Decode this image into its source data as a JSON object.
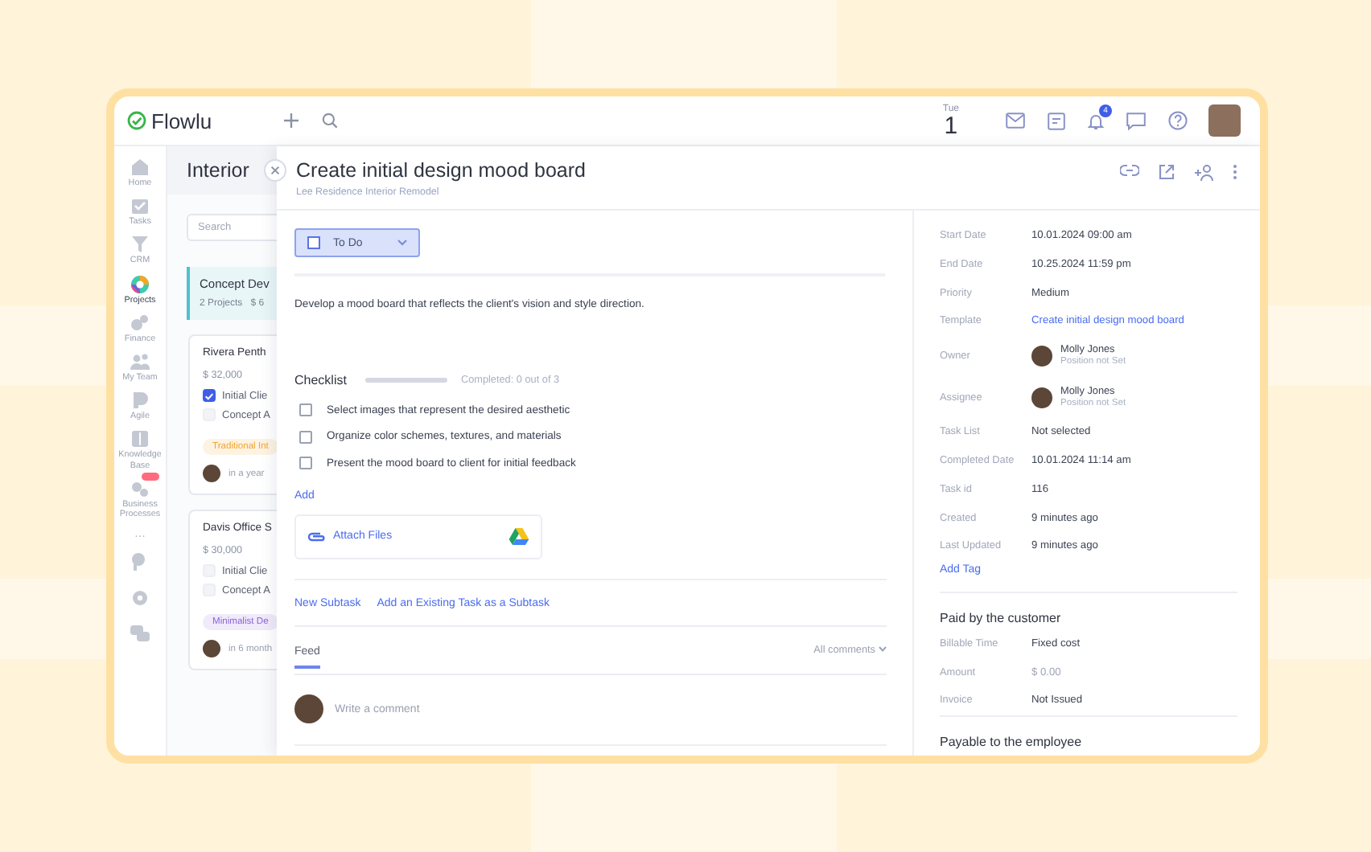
{
  "app": {
    "logo": "Flowlu"
  },
  "header": {
    "weekday": "Tue",
    "day": "1",
    "notifications": "4"
  },
  "sidebar": {
    "items": [
      {
        "label": "Home",
        "selected": false,
        "badge": false
      },
      {
        "label": "Tasks",
        "selected": false,
        "badge": false
      },
      {
        "label": "CRM",
        "selected": false,
        "badge": false
      },
      {
        "label": "Projects",
        "selected": true,
        "badge": false
      },
      {
        "label": "Finance",
        "selected": false,
        "badge": false
      },
      {
        "label": "My Team",
        "selected": false,
        "badge": false
      },
      {
        "label": "Agile",
        "selected": false,
        "badge": false
      },
      {
        "label": "Knowledge Base",
        "selected": false,
        "badge": false
      },
      {
        "label": "Business Processes",
        "selected": false,
        "badge": true
      }
    ],
    "more": "..."
  },
  "board": {
    "title": "Interior",
    "search": {
      "placeholder": "Search"
    },
    "group": {
      "title": "Concept Dev",
      "count": "2 Projects",
      "amount": "$ 6"
    },
    "cards": [
      {
        "title": "Rivera Penth",
        "amount": "$ 32,000",
        "tasks": [
          {
            "label": "Initial Clie",
            "checked": true
          },
          {
            "label": "Concept A",
            "checked": false
          }
        ],
        "tag": {
          "label": "Traditional Int",
          "color": "#f0a530"
        },
        "due": "in a year"
      },
      {
        "title": "Davis Office S",
        "amount": "$ 30,000",
        "tasks": [
          {
            "label": "Initial Clie",
            "checked": false
          },
          {
            "label": "Concept A",
            "checked": false
          }
        ],
        "tag": {
          "label": "Minimalist De",
          "color": "#8c64d8"
        },
        "due": "in 6 month"
      }
    ]
  },
  "task": {
    "title": "Create initial design mood board",
    "project": "Lee Residence Interior Remodel",
    "status": {
      "label": "To Do",
      "done": false
    },
    "description": "Develop a mood board that reflects the client's vision and style direction.",
    "checklist": {
      "title": "Checklist",
      "level": 0,
      "summary": "Completed: 0 out of 3",
      "items": [
        {
          "label": "Select images that represent the desired aesthetic",
          "checked": false
        },
        {
          "label": "Organize color schemes, textures, and materials",
          "checked": false
        },
        {
          "label": "Present the mood board to client for initial feedback",
          "checked": false
        }
      ],
      "add": "Add"
    },
    "attach": "Attach Files",
    "subtask_links": [
      "New Subtask",
      "Add an Existing Task as a Subtask"
    ],
    "feed": {
      "tab": "Feed",
      "filter": "All comments",
      "comment_placeholder": "Write a comment"
    },
    "details": [
      {
        "kind": "text",
        "label": "Start Date",
        "value": "10.01.2024 09:00 am"
      },
      {
        "kind": "text",
        "label": "End Date",
        "value": "10.25.2024 11:59 pm"
      },
      {
        "kind": "text",
        "label": "Priority",
        "value": "Medium"
      },
      {
        "kind": "link",
        "label": "Template",
        "value": "Create initial design mood board"
      },
      {
        "kind": "person",
        "label": "Owner",
        "value": "Molly Jones",
        "note": "Position not Set"
      },
      {
        "kind": "person",
        "label": "Assignee",
        "value": "Molly Jones",
        "note": "Position not Set"
      },
      {
        "kind": "text",
        "label": "Task List",
        "value": "Not selected"
      },
      {
        "kind": "text",
        "label": "Completed Date",
        "value": "10.01.2024 11:14 am"
      },
      {
        "kind": "text",
        "label": "Task id",
        "value": "116"
      },
      {
        "kind": "text",
        "label": "Created",
        "value": "9 minutes ago"
      },
      {
        "kind": "text",
        "label": "Last Updated",
        "value": "9 minutes ago"
      }
    ],
    "add_tag": "Add Tag",
    "billing": {
      "title": "Paid by the customer",
      "rows": [
        {
          "kind": "text",
          "label": "Billable Time",
          "value": "Fixed cost"
        },
        {
          "kind": "muted",
          "label": "Amount",
          "value": "$ 0.00"
        },
        {
          "kind": "text",
          "label": "Invoice",
          "value": "Not Issued"
        }
      ]
    },
    "next_section": "Payable to the employee"
  }
}
